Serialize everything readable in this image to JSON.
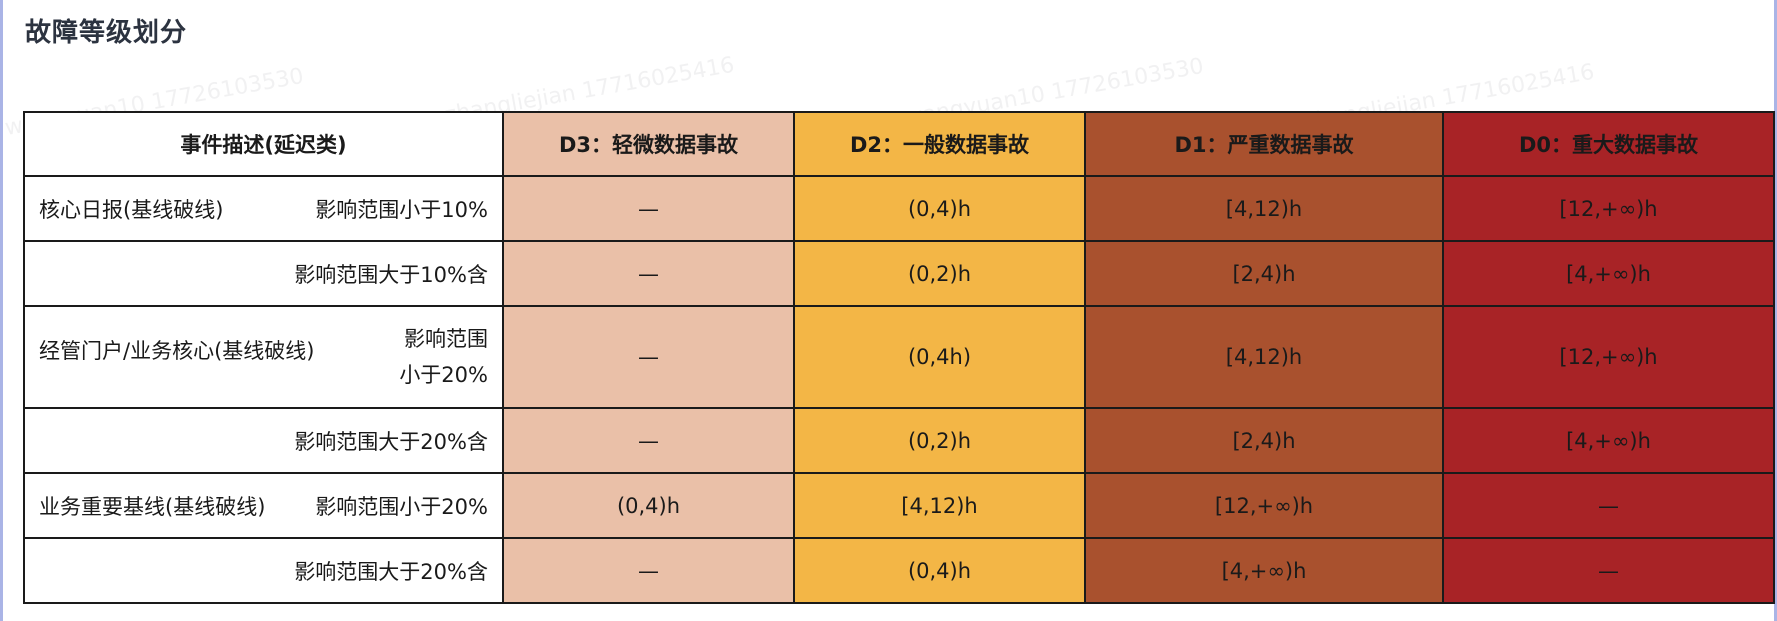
{
  "title": "故障等级划分",
  "watermarks": [
    "wangyuan10 17726103530",
    "zhangliejian 17716025416",
    "wangyuan10 17726103530",
    "zhangliejian 17716025416",
    "wangyuan10 17726103530",
    "zhangliejian 17716025416"
  ],
  "table": {
    "headers": [
      "事件描述(延迟类)",
      "D3：轻微数据事故",
      "D2：一般数据事故",
      "D1：严重数据事故",
      "D0：重大数据事故"
    ],
    "rows": [
      {
        "category": "核心日报(基线破线)",
        "scope": "影响范围小于10%",
        "d3": "—",
        "d2": "(0,4)h",
        "d1": "[4,12)h",
        "d0": "[12,+∞)h"
      },
      {
        "category": "",
        "scope": "影响范围大于10%含",
        "d3": "—",
        "d2": "(0,2)h",
        "d1": "[2,4)h",
        "d0": "[4,+∞)h"
      },
      {
        "category": "经管门户/业务核心(基线破线)",
        "scope_line1": "影响范围",
        "scope_line2": "小于20%",
        "d3": "—",
        "d2": "(0,4h)",
        "d1": "[4,12)h",
        "d0": "[12,+∞)h"
      },
      {
        "category": "",
        "scope": "影响范围大于20%含",
        "d3": "—",
        "d2": "(0,2)h",
        "d1": "[2,4)h",
        "d0": "[4,+∞)h"
      },
      {
        "category": "业务重要基线(基线破线)",
        "scope": "影响范围小于20%",
        "d3": "(0,4)h",
        "d2": "[4,12)h",
        "d1": "[12,+∞)h",
        "d0": "—"
      },
      {
        "category": "",
        "scope": "影响范围大于20%含",
        "d3": "—",
        "d2": "(0,4)h",
        "d1": "[4,+∞)h",
        "d0": "—"
      }
    ]
  }
}
